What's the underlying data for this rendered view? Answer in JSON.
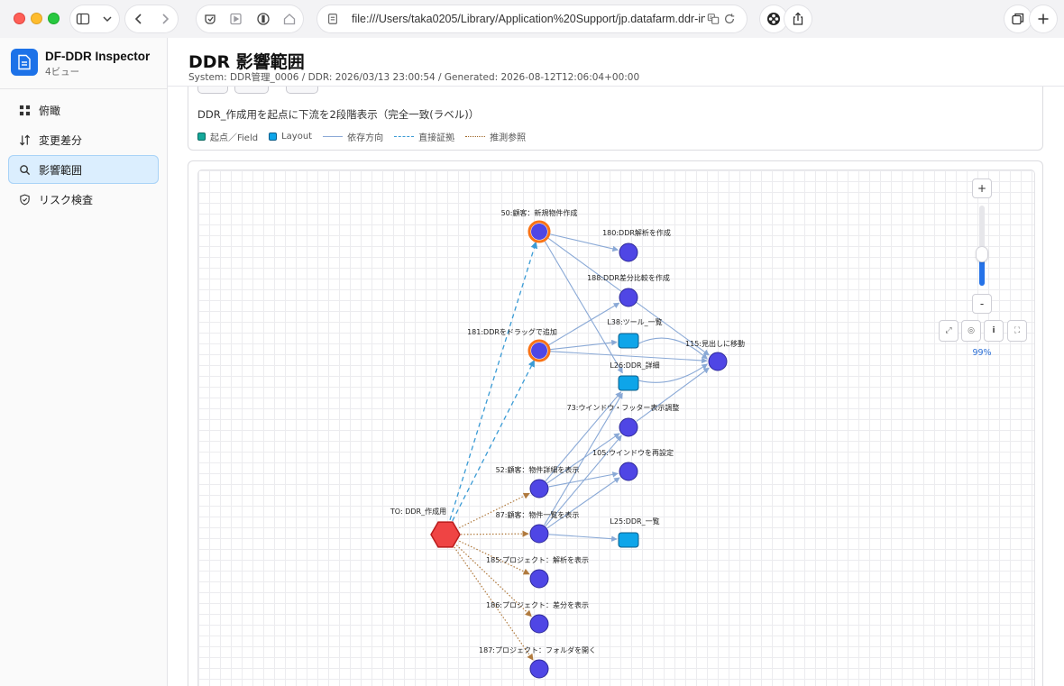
{
  "browser": {
    "url": "file:///Users/taka0205/Library/Application%20Support/jp.datafarm.ddr-inspector/",
    "icons": [
      "sidebar-toggle-icon",
      "chevron-down-icon",
      "back-icon",
      "forward-icon",
      "extension-icon",
      "media-icon",
      "shield-icon",
      "home-icon",
      "page-icon",
      "translate-icon",
      "reload-icon",
      "extensions-icon",
      "share-icon",
      "tabs-icon",
      "new-tab-icon"
    ]
  },
  "app": {
    "name": "DF-DDR Inspector",
    "subtitle": "4ビュー"
  },
  "sidebar": {
    "items": [
      {
        "label": "俯瞰",
        "icon": "grid-icon",
        "active": false
      },
      {
        "label": "変更差分",
        "icon": "swap-icon",
        "active": false
      },
      {
        "label": "影響範囲",
        "icon": "search-icon",
        "active": true
      },
      {
        "label": "リスク検査",
        "icon": "shield-check-icon",
        "active": false
      }
    ]
  },
  "page": {
    "title": "DDR 影響範囲",
    "meta": "System: DDR管理_0006 / DDR: 2026/03/13 23:00:54 / Generated: 2026-08-12T12:06:04+00:00"
  },
  "query": {
    "description": "DDR_作成用を起点に下流を2段階表示（完全一致(ラベル)）"
  },
  "legend": [
    {
      "label": "起点／Field",
      "kind": "box",
      "color": "#14a89a"
    },
    {
      "label": "Layout",
      "kind": "box",
      "color": "#0ea5e9"
    },
    {
      "label": "依存方向",
      "kind": "solid",
      "color": "#8aa9d6"
    },
    {
      "label": "直接証拠",
      "kind": "dashed",
      "color": "#3a9bd5"
    },
    {
      "label": "推測参照",
      "kind": "dotted",
      "color": "#a0682a"
    }
  ],
  "colors": {
    "accent": "#2673e8",
    "script_node": "#4f46e5",
    "layout_node": "#0ea5e9",
    "origin_node": "#ef4444",
    "highlight_ring": "#f97316"
  },
  "graph": {
    "nodes": [
      {
        "id": "TO",
        "label": "TO: DDR_作成用",
        "type": "origin"
      },
      {
        "id": "50",
        "label": "50:顧客：新規物件作成",
        "type": "script",
        "highlight": true
      },
      {
        "id": "180",
        "label": "180:DDR解析を作成",
        "type": "script"
      },
      {
        "id": "188",
        "label": "188:DDR差分比較を作成",
        "type": "script"
      },
      {
        "id": "L38",
        "label": "L38:ツール_一覧",
        "type": "layout"
      },
      {
        "id": "181",
        "label": "181:DDRをドラッグで追加",
        "type": "script",
        "highlight": true
      },
      {
        "id": "115",
        "label": "115:見出しに移動",
        "type": "script"
      },
      {
        "id": "L26",
        "label": "L26:DDR_詳細",
        "type": "layout"
      },
      {
        "id": "73",
        "label": "73:ウインドウ・フッター表示調整",
        "type": "script"
      },
      {
        "id": "105",
        "label": "105:ウインドウを再設定",
        "type": "script"
      },
      {
        "id": "52",
        "label": "52:顧客：物件詳細を表示",
        "type": "script"
      },
      {
        "id": "87",
        "label": "87:顧客：物件一覧を表示",
        "type": "script"
      },
      {
        "id": "L25",
        "label": "L25:DDR_一覧",
        "type": "layout"
      },
      {
        "id": "185",
        "label": "185:プロジェクト：解析を表示",
        "type": "script"
      },
      {
        "id": "186",
        "label": "186:プロジェクト：差分を表示",
        "type": "script"
      },
      {
        "id": "187",
        "label": "187:プロジェクト：フォルダを開く",
        "type": "script"
      }
    ],
    "edges": [
      {
        "from": "TO",
        "to": "50",
        "kind": "dashed"
      },
      {
        "from": "TO",
        "to": "181",
        "kind": "dashed"
      },
      {
        "from": "TO",
        "to": "52",
        "kind": "dotted"
      },
      {
        "from": "TO",
        "to": "87",
        "kind": "dotted"
      },
      {
        "from": "TO",
        "to": "185",
        "kind": "dotted"
      },
      {
        "from": "TO",
        "to": "186",
        "kind": "dotted"
      },
      {
        "from": "TO",
        "to": "187",
        "kind": "dotted"
      },
      {
        "from": "50",
        "to": "115",
        "kind": "solid"
      },
      {
        "from": "50",
        "to": "180",
        "kind": "solid"
      },
      {
        "from": "50",
        "to": "L26",
        "kind": "solid"
      },
      {
        "from": "181",
        "to": "188",
        "kind": "solid"
      },
      {
        "from": "181",
        "to": "L38",
        "kind": "solid"
      },
      {
        "from": "181",
        "to": "115",
        "kind": "solid"
      },
      {
        "from": "L38",
        "to": "115",
        "kind": "solid"
      },
      {
        "from": "L26",
        "to": "115",
        "kind": "solid"
      },
      {
        "from": "73",
        "to": "115",
        "kind": "solid"
      },
      {
        "from": "52",
        "to": "L26",
        "kind": "solid"
      },
      {
        "from": "52",
        "to": "73",
        "kind": "solid"
      },
      {
        "from": "52",
        "to": "105",
        "kind": "solid"
      },
      {
        "from": "87",
        "to": "L26",
        "kind": "solid"
      },
      {
        "from": "87",
        "to": "73",
        "kind": "solid"
      },
      {
        "from": "87",
        "to": "105",
        "kind": "solid"
      },
      {
        "from": "87",
        "to": "L25",
        "kind": "solid"
      }
    ]
  },
  "zoom": {
    "level_label": "99%",
    "level": 0.36,
    "zoom_in_label": "+",
    "zoom_out_label": "-",
    "tools": [
      {
        "name": "fit-icon",
        "glyph": "⤢"
      },
      {
        "name": "reset-icon",
        "glyph": "◎"
      },
      {
        "name": "info-icon",
        "glyph": "i"
      },
      {
        "name": "fullscreen-icon",
        "glyph": "⛶"
      }
    ]
  }
}
